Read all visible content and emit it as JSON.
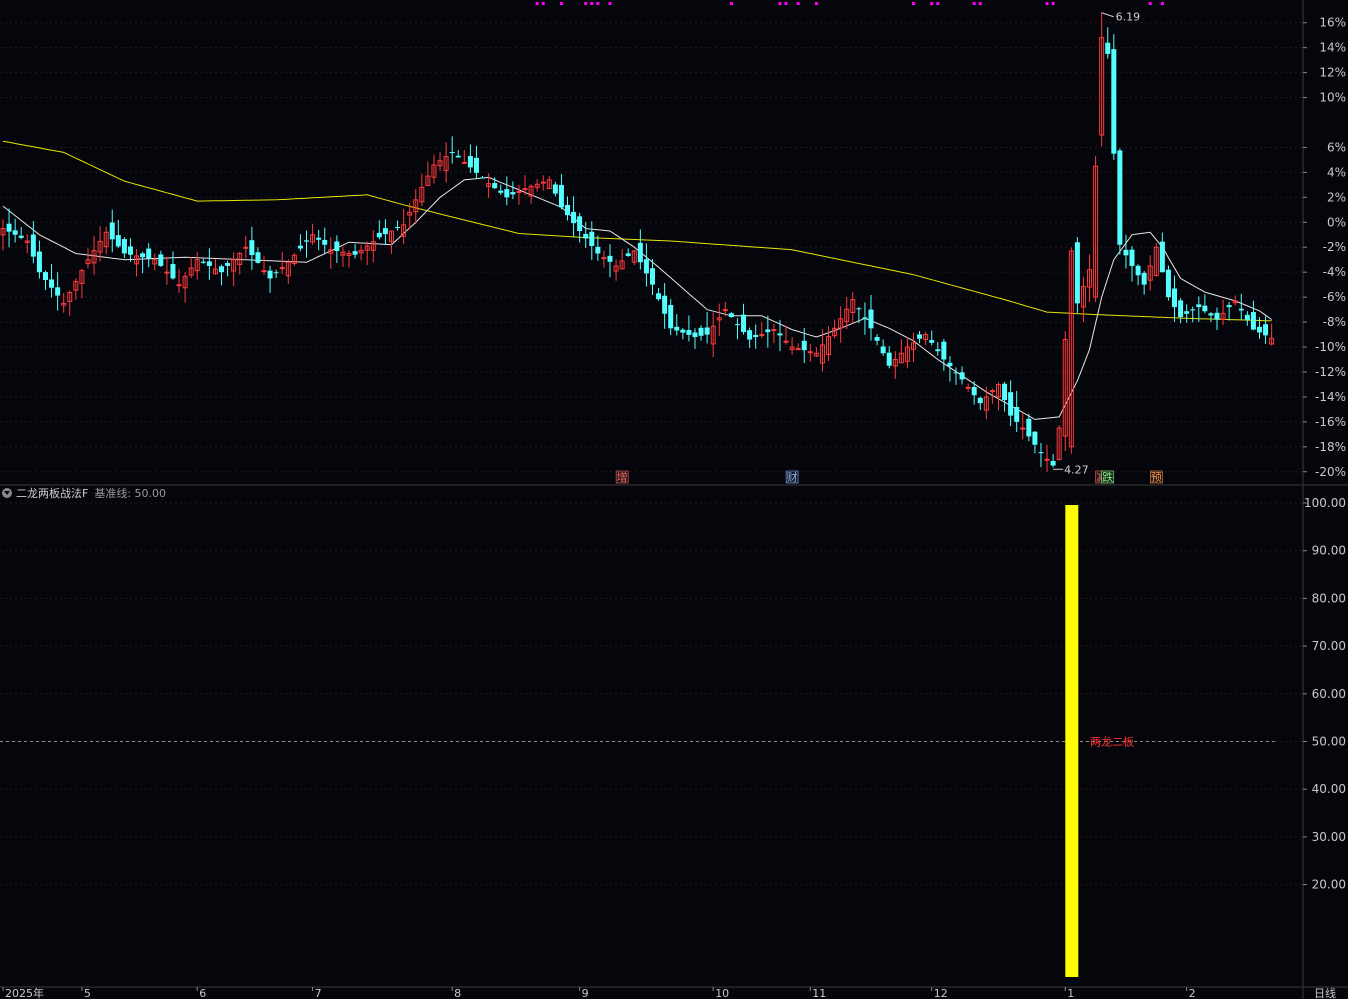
{
  "indicator": {
    "name": "二龙两板战法F",
    "baseline_label": "基准线: 50.00",
    "signal_label": "两龙二板"
  },
  "period_label": "日线",
  "colors": {
    "up": "#ff3b3b",
    "down": "#54ffff",
    "ma_long": "#e6e600",
    "ma_short": "#e8e8e8",
    "bar": "#ffff00",
    "grid": "#2a1818",
    "axis_text": "#c9c9c9"
  },
  "chart_data": {
    "type": "candlestick",
    "y_axis": {
      "ticks": [
        16,
        14,
        12,
        10,
        6,
        4,
        2,
        0,
        -2,
        -4,
        -6,
        -8,
        -10,
        -12,
        -14,
        -16,
        -18,
        -20
      ],
      "unit": "%",
      "ylim": [
        -20.5,
        17.5
      ]
    },
    "x_labels": [
      {
        "text": "2025年",
        "day": 0
      },
      {
        "text": "5",
        "day": 13
      },
      {
        "text": "6",
        "day": 32
      },
      {
        "text": "7",
        "day": 51
      },
      {
        "text": "8",
        "day": 74
      },
      {
        "text": "9",
        "day": 95
      },
      {
        "text": "10",
        "day": 117
      },
      {
        "text": "11",
        "day": 133
      },
      {
        "text": "12",
        "day": 153
      },
      {
        "text": "1",
        "day": 175
      },
      {
        "text": "2",
        "day": 195
      }
    ],
    "annotations": [
      {
        "text": "6.19",
        "day": 181,
        "value": 16.8,
        "kind": "high"
      },
      {
        "text": "4.27",
        "day": 173,
        "value": -19.8,
        "kind": "low"
      }
    ],
    "event_markers": [
      {
        "text": "增",
        "day": 102,
        "color": "#ff6060"
      },
      {
        "text": "财",
        "day": 130,
        "color": "#7fb0ff"
      },
      {
        "text": "减",
        "day": 181,
        "color": "#ff6060"
      },
      {
        "text": "跌",
        "day": 182,
        "color": "#7fff7f"
      },
      {
        "text": "预",
        "day": 190,
        "color": "#ff9040"
      }
    ],
    "top_markers": [
      88,
      89,
      92,
      96,
      97,
      98,
      100,
      120,
      128,
      129,
      131,
      134,
      150,
      153,
      154,
      160,
      161,
      172,
      173,
      189,
      191
    ],
    "anchors": [
      [
        0,
        -0.5
      ],
      [
        4,
        -1.5
      ],
      [
        6,
        -4
      ],
      [
        10,
        -6.5
      ],
      [
        14,
        -3
      ],
      [
        17,
        -0.8
      ],
      [
        20,
        -2.5
      ],
      [
        25,
        -3
      ],
      [
        29,
        -5
      ],
      [
        32,
        -3
      ],
      [
        36,
        -4
      ],
      [
        40,
        -2
      ],
      [
        44,
        -4.5
      ],
      [
        47,
        -3.2
      ],
      [
        51,
        -1
      ],
      [
        54,
        -2.2
      ],
      [
        58,
        -2.6
      ],
      [
        62,
        -1.2
      ],
      [
        66,
        -0.2
      ],
      [
        69,
        2.8
      ],
      [
        71,
        4.6
      ],
      [
        74,
        5.6
      ],
      [
        77,
        4.4
      ],
      [
        80,
        3.1
      ],
      [
        83,
        2
      ],
      [
        86,
        2.7
      ],
      [
        90,
        3.4
      ],
      [
        92,
        1.2
      ],
      [
        95,
        -0.7
      ],
      [
        98,
        -2.5
      ],
      [
        101,
        -3.5
      ],
      [
        104,
        -2.3
      ],
      [
        107,
        -5
      ],
      [
        110,
        -8.5
      ],
      [
        114,
        -9.2
      ],
      [
        116,
        -9
      ],
      [
        119,
        -7
      ],
      [
        123,
        -9.4
      ],
      [
        127,
        -8.6
      ],
      [
        130,
        -10
      ],
      [
        134,
        -10.5
      ],
      [
        137,
        -8.5
      ],
      [
        140,
        -6.2
      ],
      [
        143,
        -8.5
      ],
      [
        146,
        -11.5
      ],
      [
        149,
        -10
      ],
      [
        152,
        -9
      ],
      [
        155,
        -11
      ],
      [
        158,
        -12.6
      ],
      [
        161,
        -14.5
      ],
      [
        164,
        -13
      ],
      [
        166,
        -15.5
      ],
      [
        168,
        -16.5
      ],
      [
        171,
        -18.5
      ],
      [
        173,
        -19.5
      ],
      [
        174,
        -16.5
      ],
      [
        176,
        -2.3
      ],
      [
        177,
        -6.5
      ],
      [
        179,
        -3.8
      ],
      [
        180,
        4.5
      ],
      [
        181,
        14.8
      ],
      [
        182,
        13.5
      ],
      [
        183,
        5.5
      ],
      [
        184,
        -1.8
      ],
      [
        186,
        -3.5
      ],
      [
        188,
        -5
      ],
      [
        190,
        -2
      ],
      [
        192,
        -6
      ],
      [
        194,
        -7.6
      ],
      [
        197,
        -6.8
      ],
      [
        200,
        -7.8
      ],
      [
        203,
        -6.3
      ],
      [
        206,
        -8.6
      ],
      [
        209,
        -9.3
      ]
    ],
    "ma_long_anchors": [
      [
        0,
        6.5
      ],
      [
        10,
        5.6
      ],
      [
        20,
        3.3
      ],
      [
        32,
        1.7
      ],
      [
        45,
        1.8
      ],
      [
        60,
        2.2
      ],
      [
        66,
        1.4
      ],
      [
        75,
        0.3
      ],
      [
        85,
        -0.9
      ],
      [
        95,
        -1.2
      ],
      [
        110,
        -1.5
      ],
      [
        130,
        -2.2
      ],
      [
        150,
        -4.2
      ],
      [
        165,
        -6.2
      ],
      [
        172,
        -7.2
      ],
      [
        180,
        -7.4
      ],
      [
        195,
        -7.7
      ],
      [
        209,
        -7.9
      ]
    ],
    "ma_short_anchors": [
      [
        0,
        1.3
      ],
      [
        6,
        -1
      ],
      [
        12,
        -2.5
      ],
      [
        20,
        -3
      ],
      [
        30,
        -2.8
      ],
      [
        40,
        -3
      ],
      [
        50,
        -3.2
      ],
      [
        57,
        -1.6
      ],
      [
        64,
        -1.8
      ],
      [
        68,
        0
      ],
      [
        72,
        2
      ],
      [
        76,
        3.4
      ],
      [
        80,
        3.6
      ],
      [
        86,
        2.4
      ],
      [
        92,
        1.2
      ],
      [
        96,
        -0.5
      ],
      [
        100,
        -0.7
      ],
      [
        104,
        -2
      ],
      [
        108,
        -3.6
      ],
      [
        112,
        -5.3
      ],
      [
        116,
        -7
      ],
      [
        120,
        -7.5
      ],
      [
        125,
        -7.5
      ],
      [
        130,
        -8.6
      ],
      [
        134,
        -9.2
      ],
      [
        138,
        -8.5
      ],
      [
        142,
        -7.7
      ],
      [
        146,
        -8.5
      ],
      [
        150,
        -9.5
      ],
      [
        154,
        -11
      ],
      [
        158,
        -12.3
      ],
      [
        162,
        -13.6
      ],
      [
        166,
        -14.7
      ],
      [
        170,
        -15.8
      ],
      [
        174,
        -15.6
      ],
      [
        177,
        -12.7
      ],
      [
        179,
        -10.2
      ],
      [
        181,
        -6
      ],
      [
        183,
        -3
      ],
      [
        186,
        -1
      ],
      [
        189,
        -0.8
      ],
      [
        191,
        -2
      ],
      [
        194,
        -4.5
      ],
      [
        198,
        -5.6
      ],
      [
        203,
        -6.3
      ],
      [
        207,
        -7.1
      ],
      [
        209,
        -7.8
      ]
    ],
    "indicator_series": {
      "type": "bar",
      "y_ticks": [
        100,
        90,
        80,
        70,
        60,
        50,
        40,
        30,
        20
      ],
      "ylim": [
        0,
        100
      ],
      "baseline": 50,
      "bars": [
        {
          "day": 176,
          "value": 100
        }
      ]
    }
  }
}
